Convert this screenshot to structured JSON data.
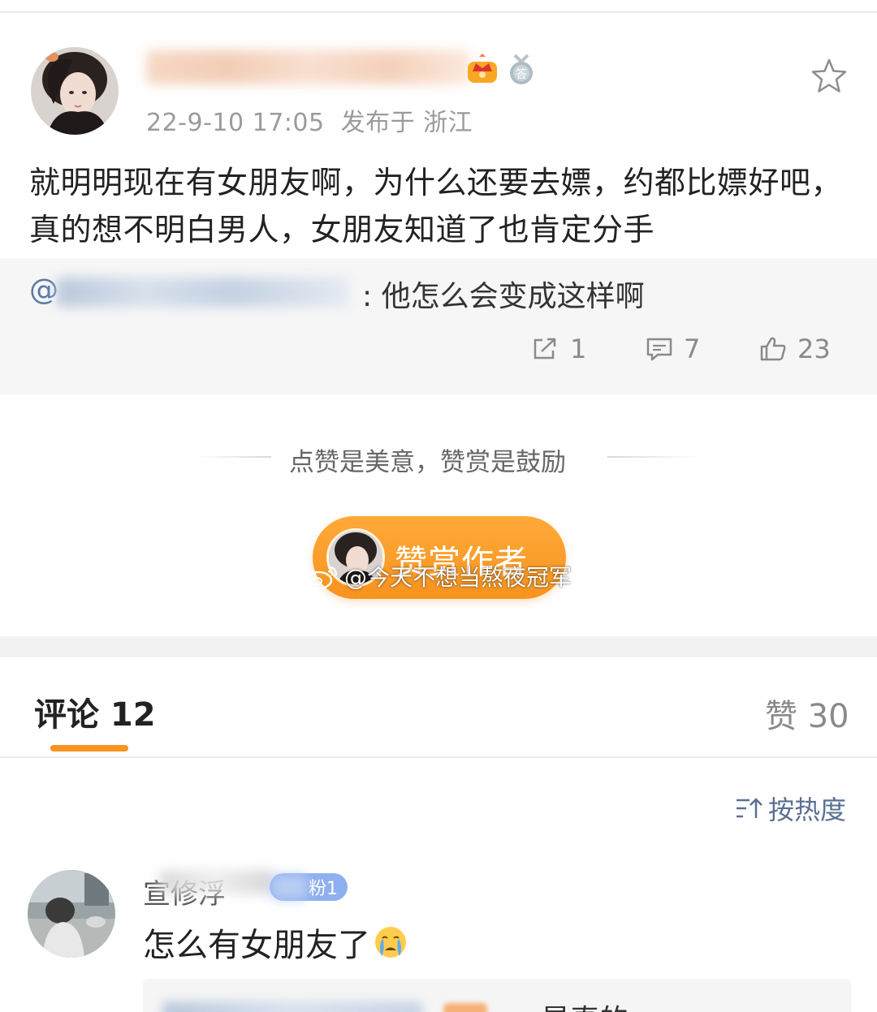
{
  "post": {
    "timestamp": "22-9-10 17:05",
    "location": "发布于 浙江",
    "text": "就明明现在有女朋友啊，为什么还要去嫖，约都比嫖好吧，真的想不明白男人，女朋友知道了也肯定分手",
    "badges": [
      "crown-vip-icon",
      "answer-medal-icon"
    ],
    "favorite_icon": "star-outline-icon"
  },
  "quote": {
    "at_sign": "@",
    "text": ": 他怎么会变成这样啊",
    "actions": {
      "share_count": "1",
      "comment_count": "7",
      "like_count": "23"
    }
  },
  "reward": {
    "hint": "点赞是美意，赞赏是鼓励",
    "button_label": "赞赏作者",
    "watermark": "@今天不想当熬夜冠军"
  },
  "comments_header": {
    "tab_label": "评论 12",
    "likes_label": "赞 30",
    "sort_label": "按热度"
  },
  "comment": {
    "fan_badge": "粉1",
    "text": "怎么有女朋友了",
    "emoji": "crying-face-icon",
    "reply_snippet": "是真的"
  },
  "colors": {
    "accent_orange": "#f7931e",
    "link_blue": "#5a79a5",
    "muted_gray": "#8a8a8a",
    "quote_bg": "#f6f6f6"
  }
}
